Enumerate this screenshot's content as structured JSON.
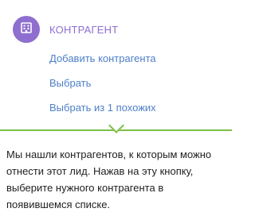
{
  "header": {
    "icon": "building-icon",
    "accent_color": "#8e6fcf",
    "title": "КОНТРАГЕНТ"
  },
  "actions": {
    "add_label": "Добавить контрагента",
    "choose_label": "Выбрать",
    "choose_similar_label": "Выбрать из 1 похожих",
    "link_color": "#4d7fc9"
  },
  "hint": {
    "text": "Мы нашли контрагентов, к которым можно отнести этот лид. Нажав на эту кнопку, выберите нужного контрагента в появившемся списке.",
    "divider_color": "#7cbf4a"
  }
}
